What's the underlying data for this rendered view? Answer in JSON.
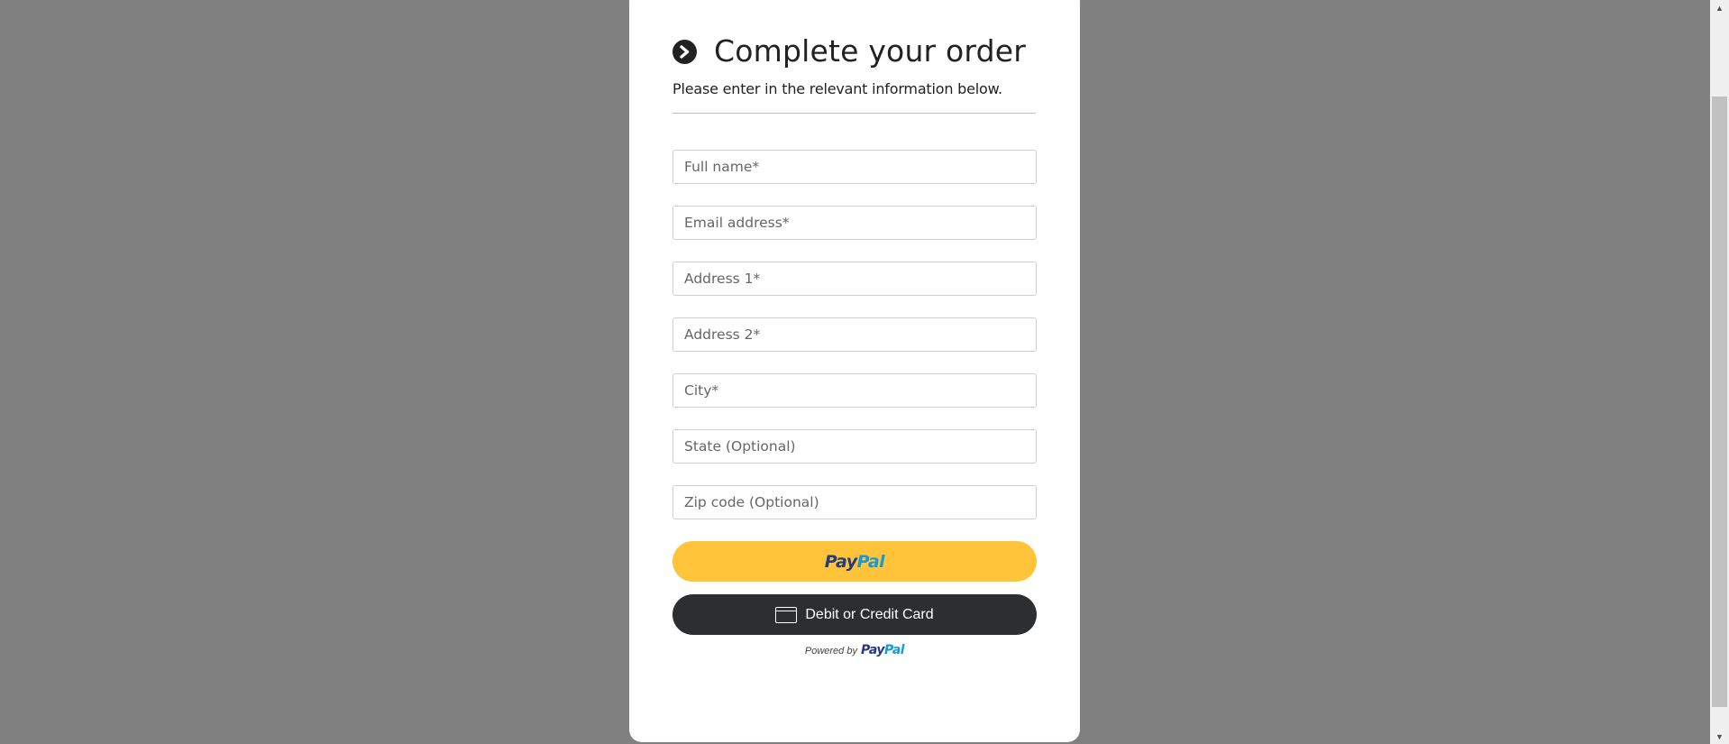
{
  "order_form": {
    "title": "Complete your order",
    "subtitle": "Please enter in the relevant information below.",
    "fields": {
      "full_name": "Full name*",
      "email": "Email address*",
      "address1": "Address 1*",
      "address2": "Address 2*",
      "city": "City*",
      "state": "State (Optional)",
      "zip": "Zip code (Optional)"
    }
  },
  "payment": {
    "paypal_button": {
      "logo_part1": "Pay",
      "logo_part2": "Pal"
    },
    "card_button": {
      "label": "Debit or Credit Card",
      "icon": "credit-card-icon"
    },
    "powered_by": {
      "text": "Powered by",
      "logo_part1": "Pay",
      "logo_part2": "Pal"
    }
  },
  "icons": {
    "title_icon": "chevron-right-circle-icon"
  },
  "colors": {
    "backdrop": "#808080",
    "paypal_yellow": "#ffc439",
    "card_button_dark": "#2c2e2f",
    "paypal_dark_blue": "#253b80",
    "paypal_light_blue": "#179bd7"
  }
}
